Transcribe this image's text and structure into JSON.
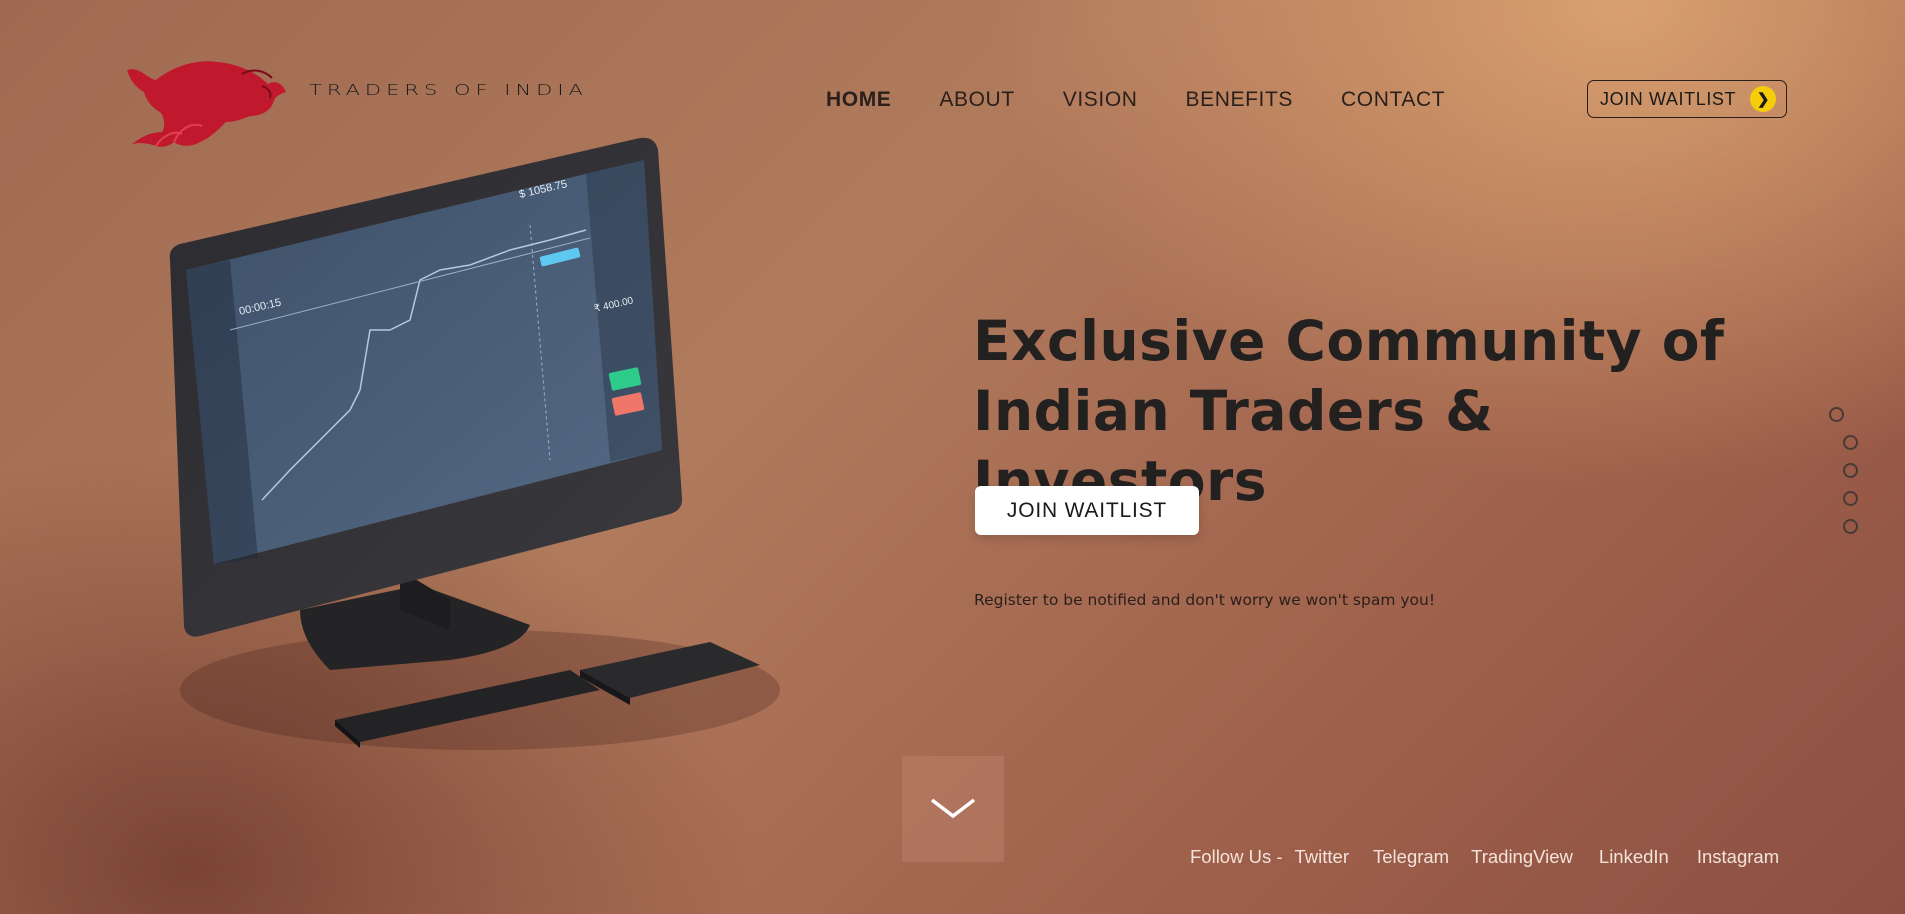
{
  "brand": {
    "name": "TRADERS OF INDIA",
    "logo_icon": "bull-icon",
    "logo_color": "#c8102e"
  },
  "nav": {
    "items": [
      {
        "label": "HOME",
        "active": true
      },
      {
        "label": "ABOUT",
        "active": false
      },
      {
        "label": "VISION",
        "active": false
      },
      {
        "label": "BENEFITS",
        "active": false
      },
      {
        "label": "CONTACT",
        "active": false
      }
    ]
  },
  "header_cta": {
    "label": "JOIN WAITLIST",
    "icon": "chevron-right-icon",
    "icon_color": "#f5cd0a"
  },
  "hero": {
    "headline_line1": "Exclusive Community of",
    "headline_line2": "Indian Traders & Investors",
    "cta_label": "JOIN WAITLIST",
    "subtext": "Register to be notified and don't worry we won't spam you!"
  },
  "screen": {
    "price": "$ 1058.75",
    "timer": "00:00:15",
    "amount": "₹ 400.00"
  },
  "side_dots": {
    "count": 5,
    "active_index": 0
  },
  "scroll_button": {
    "icon": "chevron-down-icon"
  },
  "social": {
    "label": "Follow Us -",
    "links": [
      "Twitter",
      "Telegram",
      "TradingView",
      "LinkedIn",
      "Instagram"
    ]
  }
}
